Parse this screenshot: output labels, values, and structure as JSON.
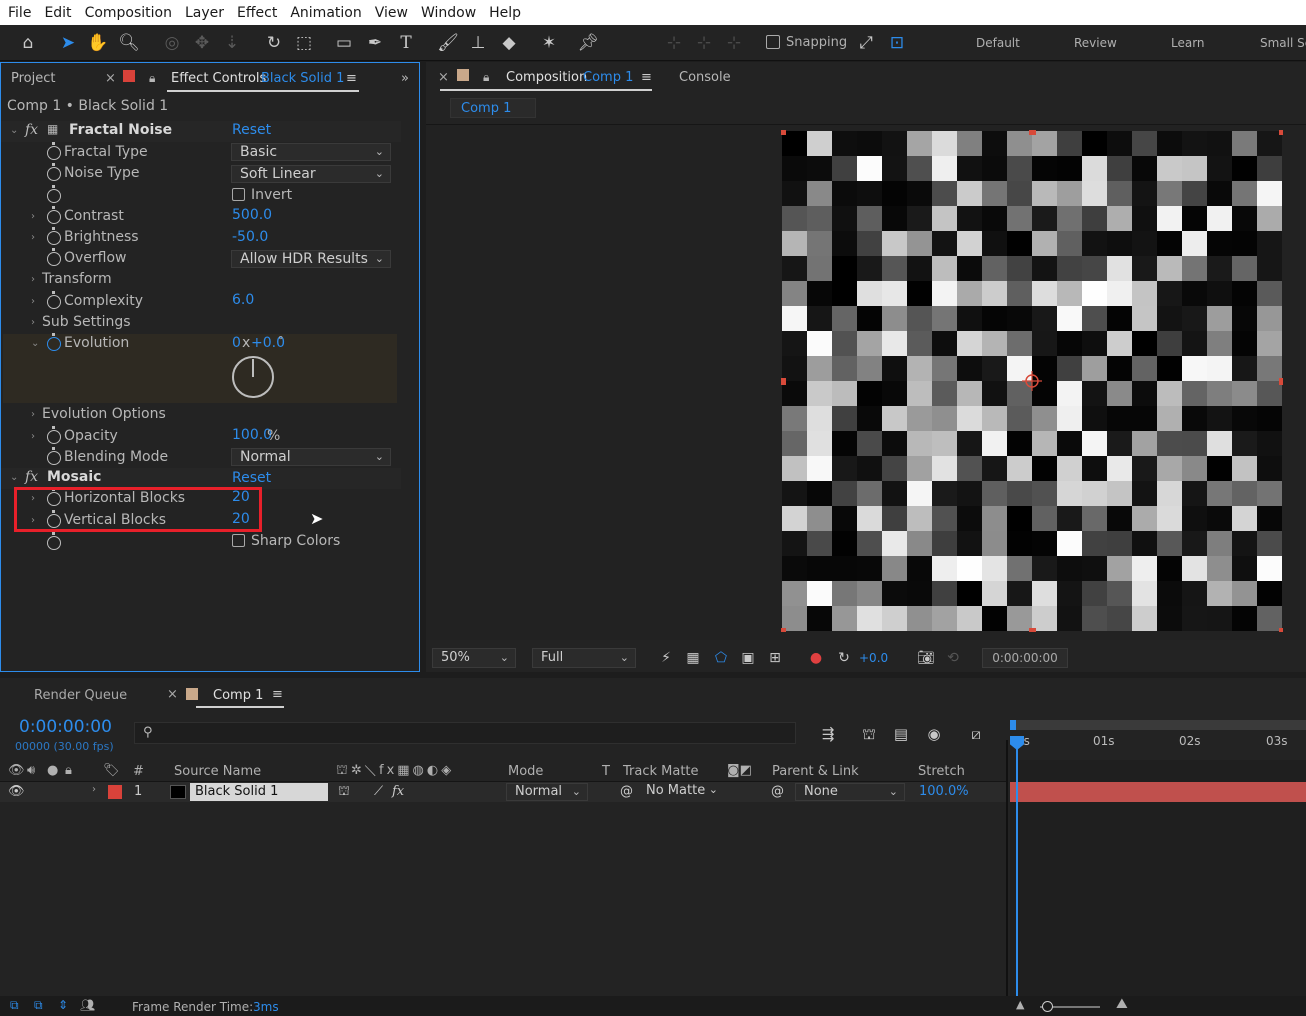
{
  "menu": [
    "File",
    "Edit",
    "Composition",
    "Layer",
    "Effect",
    "Animation",
    "View",
    "Window",
    "Help"
  ],
  "toolbar": {
    "snapping_label": "Snapping",
    "workspaces": [
      "Default",
      "Review",
      "Learn",
      "Small Sc"
    ]
  },
  "left_panel": {
    "project_tab": "Project",
    "effect_controls_tab": "Effect Controls",
    "effect_controls_layer": "Black Solid 1",
    "breadcrumb": "Comp 1 • Black Solid 1",
    "effects": {
      "fractal_noise": {
        "name": "Fractal Noise",
        "reset": "Reset",
        "fractal_type_label": "Fractal Type",
        "fractal_type_value": "Basic",
        "noise_type_label": "Noise Type",
        "noise_type_value": "Soft Linear",
        "invert_label": "Invert",
        "contrast_label": "Contrast",
        "contrast_value": "500.0",
        "brightness_label": "Brightness",
        "brightness_value": "-50.0",
        "overflow_label": "Overflow",
        "overflow_value": "Allow HDR Results",
        "transform_label": "Transform",
        "complexity_label": "Complexity",
        "complexity_value": "6.0",
        "sub_settings_label": "Sub Settings",
        "evolution_label": "Evolution",
        "evolution_revs": "0",
        "evolution_x": "x",
        "evolution_degrees": "+0.0",
        "evolution_unit": "°",
        "evolution_options_label": "Evolution Options",
        "opacity_label": "Opacity",
        "opacity_value": "100.0",
        "opacity_unit": "%",
        "blending_mode_label": "Blending Mode",
        "blending_mode_value": "Normal"
      },
      "mosaic": {
        "name": "Mosaic",
        "reset": "Reset",
        "horizontal_blocks_label": "Horizontal Blocks",
        "horizontal_blocks_value": "20",
        "vertical_blocks_label": "Vertical Blocks",
        "vertical_blocks_value": "20",
        "sharp_colors_label": "Sharp Colors"
      }
    }
  },
  "comp_panel": {
    "composition_tab": "Composition",
    "composition_name": "Comp 1",
    "console_tab": "Console",
    "comp_subtab": "Comp 1",
    "zoom": "50%",
    "resolution": "Full",
    "exposure": "+0.0",
    "timecode": "0:00:00:00"
  },
  "timeline": {
    "render_queue_tab": "Render Queue",
    "comp_tab": "Comp 1",
    "current_time": "0:00:00:00",
    "frame_info": "00000 (30.00 fps)",
    "columns": {
      "hash": "#",
      "source_name": "Source Name",
      "mode": "Mode",
      "t": "T",
      "track_matte": "Track Matte",
      "parent_link": "Parent & Link",
      "stretch": "Stretch"
    },
    "ruler": [
      "0s",
      "01s",
      "02s",
      "03s"
    ],
    "layer": {
      "number": "1",
      "name": "Black Solid 1",
      "mode": "Normal",
      "track_matte": "No Matte",
      "parent": "None",
      "stretch": "100.0%"
    }
  },
  "status": {
    "frame_render_label": "Frame Render Time:",
    "frame_render_value": "3ms"
  },
  "colors": {
    "accent": "#2d8ceb",
    "label_red": "#d9423a",
    "highlight_box": "#e8202a",
    "layer_bar": "#c0504d"
  }
}
